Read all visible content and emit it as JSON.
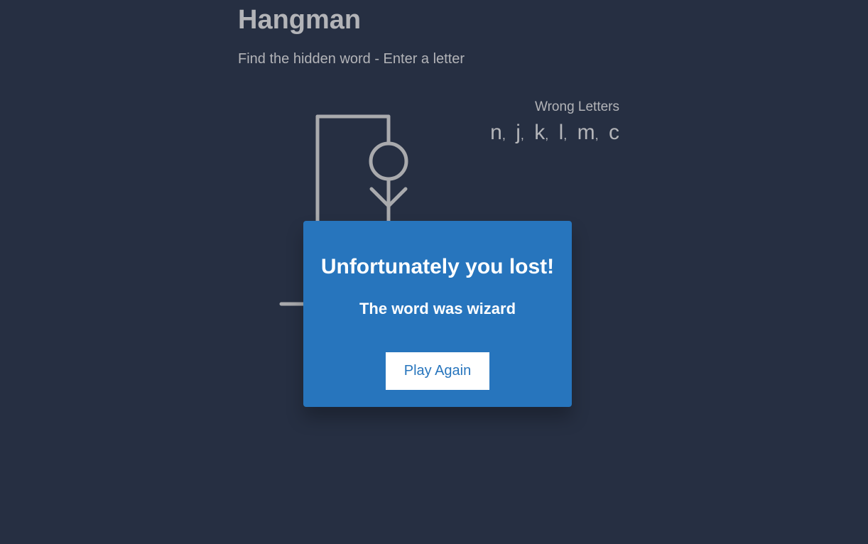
{
  "header": {
    "title": "Hangman",
    "subtitle": "Find the hidden word - Enter a letter"
  },
  "wrong_letters": {
    "label": "Wrong Letters",
    "letters": [
      "n",
      "j",
      "k",
      "l",
      "m",
      "c"
    ]
  },
  "popup": {
    "title": "Unfortunately you lost!",
    "word_message": "The word was wizard",
    "play_again_label": "Play Again"
  },
  "colors": {
    "background": "#262f42",
    "text": "#b3b4b8",
    "popup": "#2775bd",
    "button_bg": "#ffffff"
  }
}
